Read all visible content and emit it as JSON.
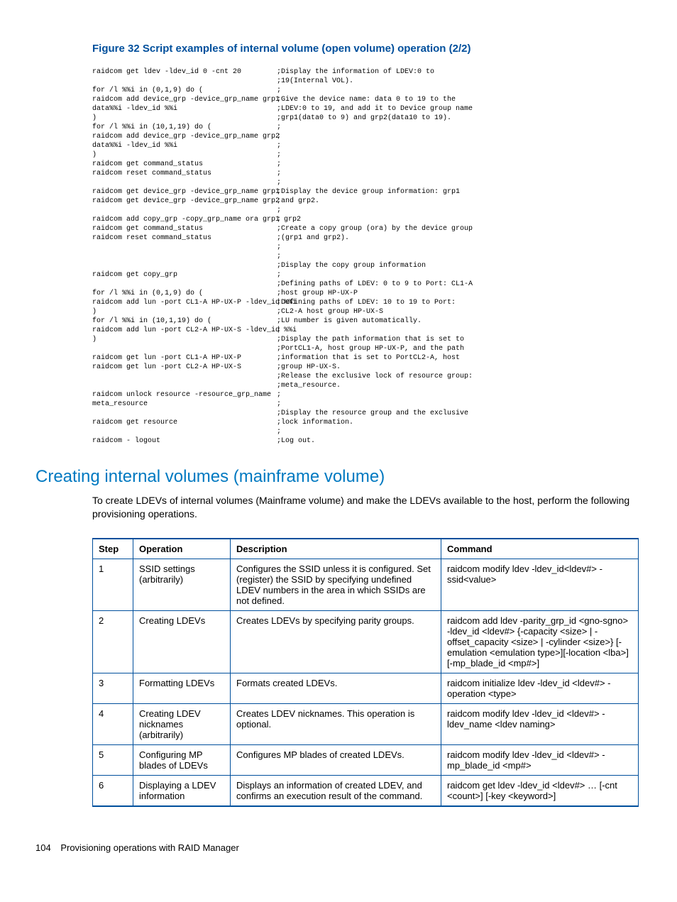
{
  "figure": {
    "title": "Figure 32 Script examples of internal volume (open volume) operation (2/2)"
  },
  "code": {
    "left": "raidcom get ldev -ldev_id 0 -cnt 20\n\nfor /l %%i in (0,1,9) do (\nraidcom add device_grp -device_grp_name grp1\ndata%%i -ldev_id %%i\n)\nfor /l %%i in (10,1,19) do (\nraidcom add device_grp -device_grp_name grp2\ndata%%i -ldev_id %%i\n)\nraidcom get command_status\nraidcom reset command_status\n\nraidcom get device_grp -device_grp_name grp1\nraidcom get device_grp -device_grp_name grp2\n\nraidcom add copy_grp -copy_grp_name ora grp1 grp2\nraidcom get command_status\nraidcom reset command_status\n\n\n\nraidcom get copy_grp\n\nfor /l %%i in (0,1,9) do (\nraidcom add lun -port CL1-A HP-UX-P -ldev_id %%i\n)\nfor /l %%i in (10,1,19) do (\nraidcom add lun -port CL2-A HP-UX-S -ldev_id %%i\n)\n\nraidcom get lun -port CL1-A HP-UX-P\nraidcom get lun -port CL2-A HP-UX-S\n\n\nraidcom unlock resource -resource_grp_name\nmeta_resource\n\nraidcom get resource\n\nraidcom - logout",
    "right": ";Display the information of LDEV:0 to\n;19(Internal VOL).\n;\n;Give the device name: data 0 to 19 to the\n;LDEV:0 to 19, and add it to Device group name\n;grp1(data0 to 9) and grp2(data10 to 19).\n;\n;\n;\n;\n;\n;\n;\n;Display the device group information: grp1\n;and grp2.\n;\n;\n;Create a copy group (ora) by the device group\n;(grp1 and grp2).\n;\n;\n;Display the copy group information\n;\n;Defining paths of LDEV: 0 to 9 to Port: CL1-A\n;host group HP-UX-P\n;Defining paths of LDEV: 10 to 19 to Port:\n;CL2-A host group HP-UX-S\n;LU number is given automatically.\n;\n;Display the path information that is set to\n;PortCL1-A, host group HP-UX-P, and the path\n;information that is set to PortCL2-A, host\n;group HP-UX-S.\n;Release the exclusive lock of resource group:\n;meta_resource.\n;\n;\n;Display the resource group and the exclusive\n;lock information.\n;\n;Log out."
  },
  "section": {
    "heading": "Creating internal volumes (mainframe volume)",
    "intro": "To create LDEVs of internal volumes (Mainframe volume) and make the LDEVs available to the host, perform the following provisioning operations."
  },
  "table": {
    "headers": {
      "step": "Step",
      "op": "Operation",
      "desc": "Description",
      "cmd": "Command"
    },
    "rows": [
      {
        "step": "1",
        "op": "SSID settings (arbitrarily)",
        "desc": "Configures the SSID unless it is configured. Set (register) the SSID by specifying undefined LDEV numbers in the area in which SSIDs are not defined.",
        "cmd": "raidcom modify ldev -ldev_id<ldev#> -ssid<value>"
      },
      {
        "step": "2",
        "op": "Creating LDEVs",
        "desc": "Creates LDEVs by specifying parity groups.",
        "cmd": "raidcom add ldev -parity_grp_id <gno-sgno> -ldev_id <ldev#> {-capacity <size> | -offset_capacity <size> | -cylinder <size>} [-emulation <emulation type>][-location <lba>][-mp_blade_id <mp#>]"
      },
      {
        "step": "3",
        "op": "Formatting LDEVs",
        "desc": "Formats created LDEVs.",
        "cmd": "raidcom initialize ldev -ldev_id <ldev#> -operation <type>"
      },
      {
        "step": "4",
        "op": "Creating LDEV nicknames (arbitrarily)",
        "desc": "Creates LDEV nicknames. This operation is optional.",
        "cmd": "raidcom modify ldev -ldev_id <ldev#> -ldev_name <ldev naming>"
      },
      {
        "step": "5",
        "op": "Configuring MP blades of LDEVs",
        "desc": "Configures MP blades of created LDEVs.",
        "cmd": "raidcom modify ldev -ldev_id <ldev#> -mp_blade_id <mp#>"
      },
      {
        "step": "6",
        "op": "Displaying a LDEV information",
        "desc": "Displays an information of created LDEV, and confirms an execution result of the command.",
        "cmd": "raidcom get ldev -ldev_id <ldev#> … [-cnt <count>] [-key <keyword>]"
      }
    ]
  },
  "footer": {
    "page": "104",
    "title": "Provisioning operations with RAID Manager"
  }
}
